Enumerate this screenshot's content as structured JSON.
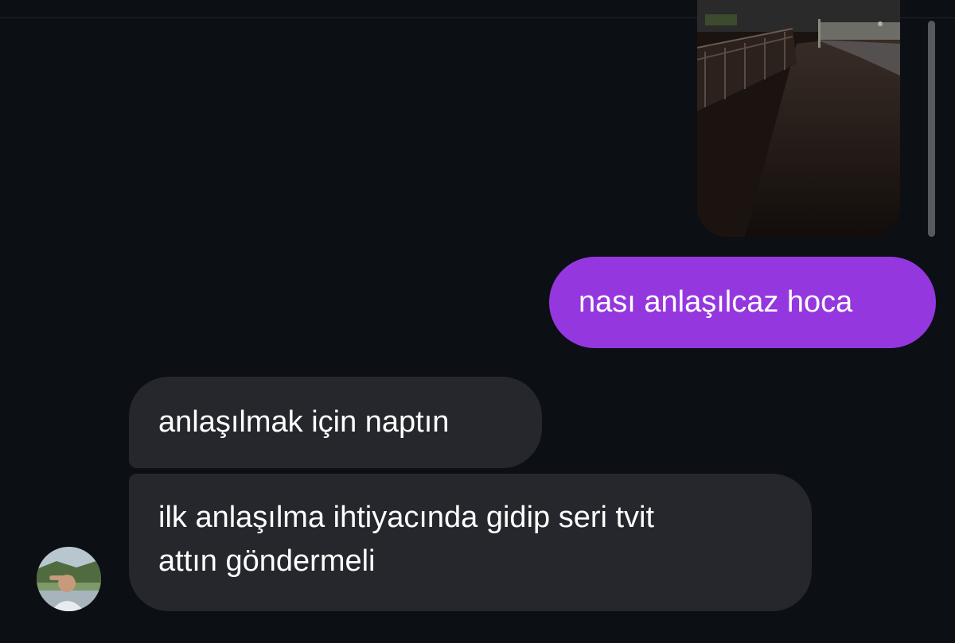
{
  "conversation": {
    "messages": [
      {
        "direction": "sent",
        "type": "image",
        "icon": "photo-thumbnail"
      },
      {
        "direction": "sent",
        "type": "text",
        "text": "nası anlaşılcaz hoca"
      },
      {
        "direction": "received",
        "type": "text",
        "text": "anlaşılmak için naptın"
      },
      {
        "direction": "received",
        "type": "text",
        "lines": [
          "ilk anlaşılma ihtiyacında gidip seri tvit",
          "attın göndermeli"
        ]
      }
    ],
    "contact_avatar": "avatar-icon"
  },
  "colors": {
    "background": "#0c0f14",
    "sent_bubble": "#9537df",
    "received_bubble": "#25272c",
    "text": "#ffffff"
  }
}
